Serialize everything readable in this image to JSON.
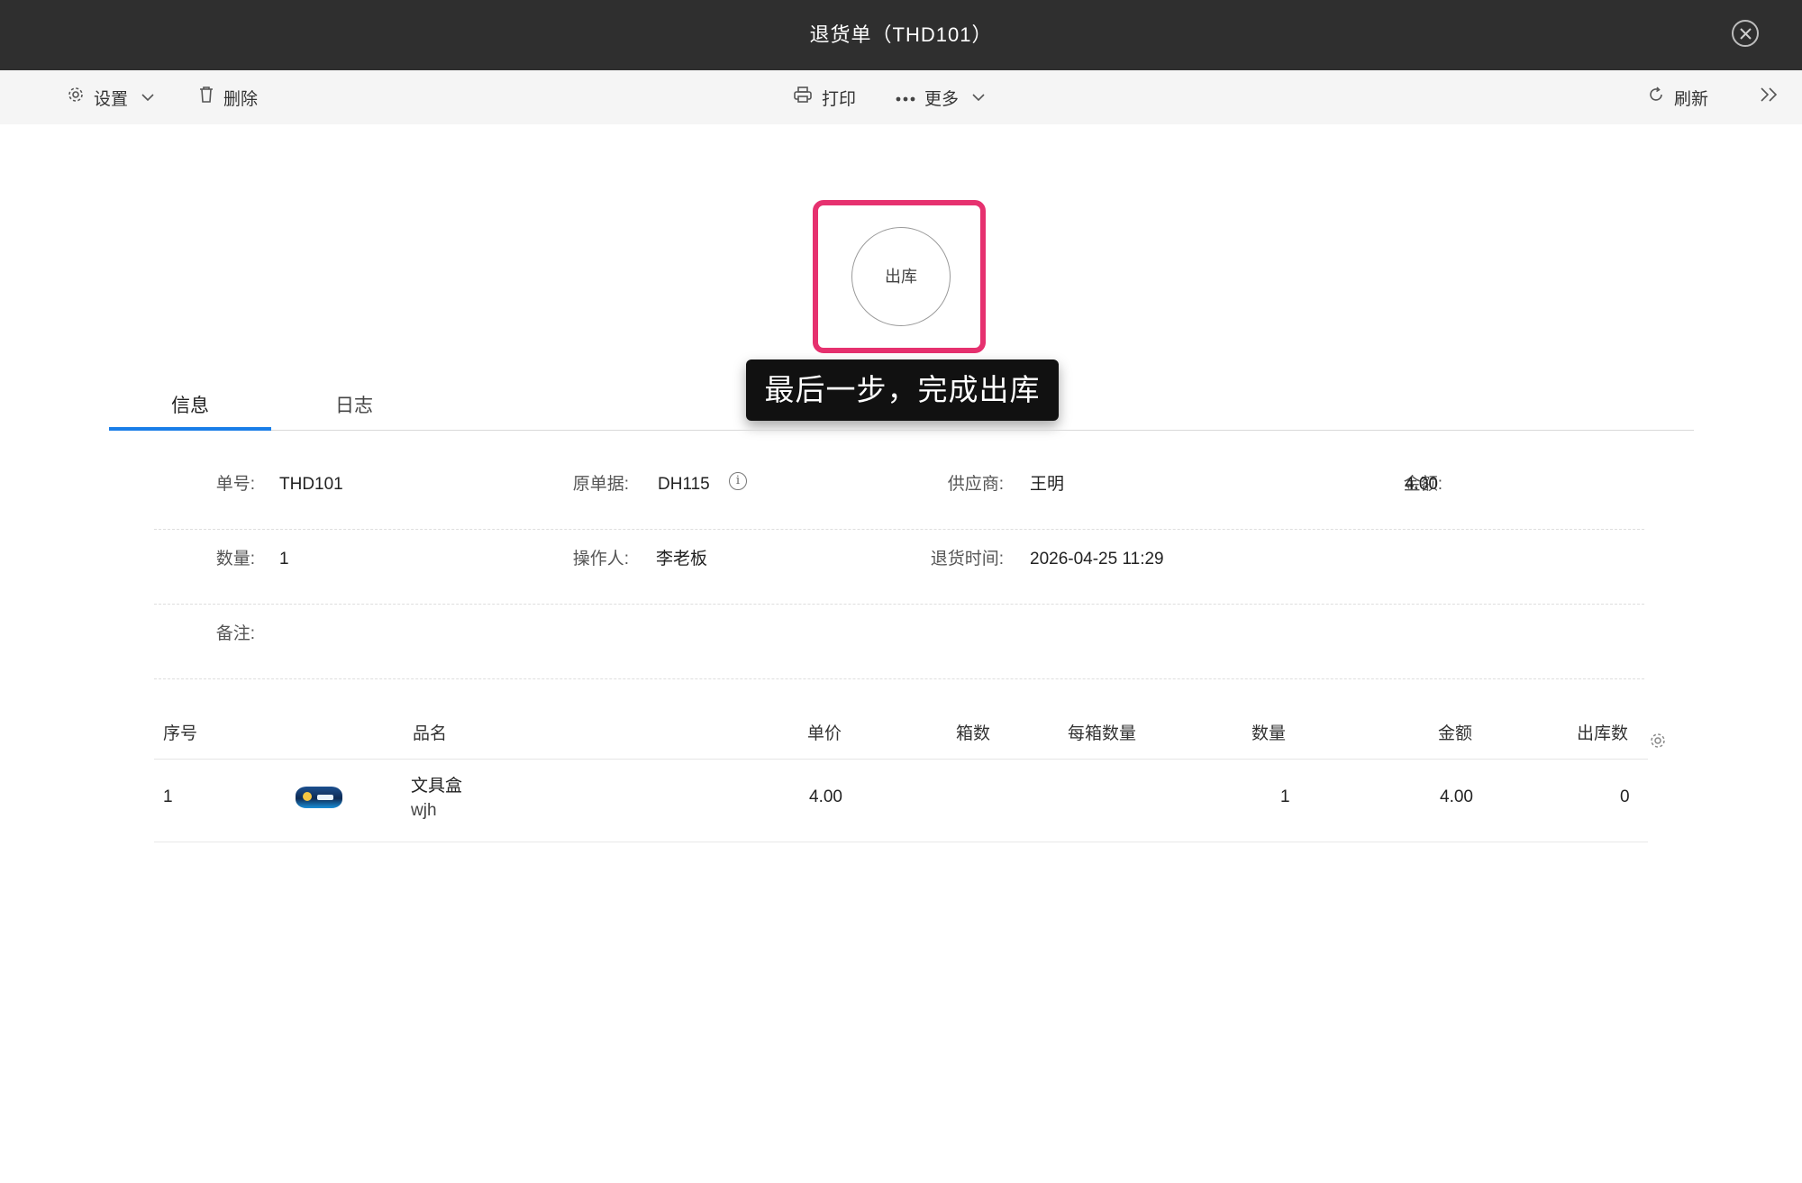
{
  "window": {
    "title": "退货单（THD101）"
  },
  "toolbar": {
    "settings": "设置",
    "delete": "删除",
    "print": "打印",
    "more": "更多",
    "refresh": "刷新"
  },
  "status": {
    "label": "出库"
  },
  "tooltip": {
    "text": "最后一步，完成出库"
  },
  "tabs": [
    {
      "label": "信息",
      "active": true
    },
    {
      "label": "日志",
      "active": false
    }
  ],
  "info": {
    "order_no_label": "单号:",
    "order_no": "THD101",
    "source_label": "原单据:",
    "source": "DH115",
    "supplier_label": "供应商:",
    "supplier": "王明",
    "amount_label": "金额:",
    "amount": "4.00",
    "qty_label": "数量:",
    "qty": "1",
    "operator_label": "操作人:",
    "operator": "李老板",
    "return_time_label": "退货时间:",
    "return_time": "2026-04-25 11:29",
    "remark_label": "备注:"
  },
  "table": {
    "headers": [
      "序号",
      "品名",
      "单价",
      "箱数",
      "每箱数量",
      "数量",
      "金额",
      "出库数"
    ],
    "rows": [
      {
        "index": "1",
        "name": "文具盒",
        "sub": "wjh",
        "price": "4.00",
        "boxes": "",
        "per_box": "",
        "qty": "1",
        "amount": "4.00",
        "out_qty": "0"
      }
    ]
  },
  "colors": {
    "accent": "#1a7ee8",
    "highlight": "#e6316f",
    "titlebar": "#2f2f2f"
  }
}
